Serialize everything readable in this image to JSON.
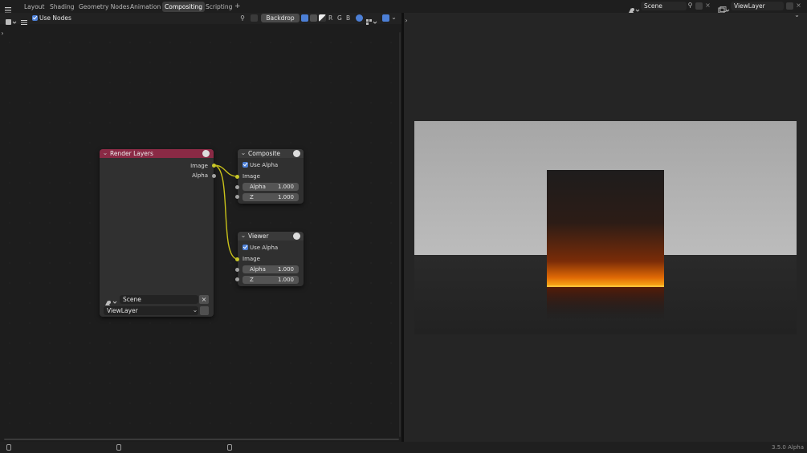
{
  "topbar": {
    "tabs": [
      "Layout",
      "Shading",
      "Geometry Nodes",
      "Animation",
      "Compositing",
      "Scripting"
    ],
    "active_tab": "Compositing",
    "add_tab": "+",
    "scene": "Scene",
    "view_layer": "ViewLayer"
  },
  "node_toolbar": {
    "use_nodes_label": "Use Nodes",
    "backdrop_label": "Backdrop",
    "channels": [
      "R",
      "G",
      "B"
    ]
  },
  "nodes": {
    "render_layers": {
      "title": "Render Layers",
      "outputs": [
        "Image",
        "Alpha"
      ],
      "scene": "Scene",
      "view_layer": "ViewLayer",
      "header_color": "#8a2a45"
    },
    "composite": {
      "title": "Composite",
      "use_alpha_label": "Use Alpha",
      "input_image": "Image",
      "alpha_label": "Alpha",
      "alpha_value": "1.000",
      "z_label": "Z",
      "z_value": "1.000"
    },
    "viewer": {
      "title": "Viewer",
      "use_alpha_label": "Use Alpha",
      "input_image": "Image",
      "alpha_label": "Alpha",
      "alpha_value": "1.000",
      "z_label": "Z",
      "z_value": "1.000"
    }
  },
  "status": {
    "version": "3.5.0 Alpha"
  },
  "colors": {
    "accent": "#4c7fd6",
    "link": "#c9c21a",
    "socket_image": "#c7c729",
    "socket_value": "#a1a1a1"
  }
}
